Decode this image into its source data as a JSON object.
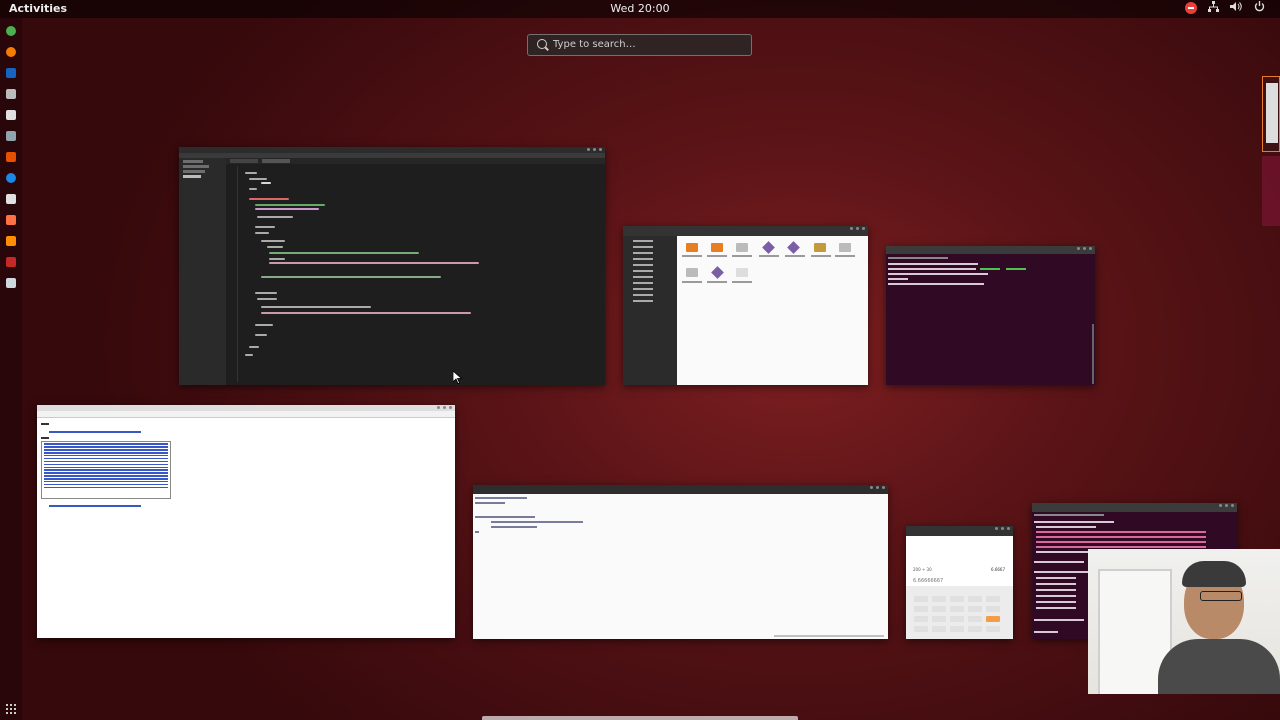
{
  "topbar": {
    "activities_label": "Activities",
    "clock": "Wed 20:00",
    "tray_icons": [
      "notification-blocked-icon",
      "network-icon",
      "volume-icon",
      "power-icon"
    ]
  },
  "search": {
    "placeholder": "Type to search…"
  },
  "dock": {
    "items": [
      "chrome-icon",
      "firefox-icon",
      "terminal-icon",
      "files-icon",
      "text-editor-icon",
      "sublime-icon",
      "settings-icon",
      "help-icon",
      "software-icon",
      "ubuntu-software-icon",
      "calculator-icon",
      "sublime-text-icon",
      "mysql-workbench-icon",
      "app-icon"
    ],
    "show_apps_icon": "show-applications-icon"
  },
  "windows": [
    {
      "id": "sublime",
      "app": "Sublime Text"
    },
    {
      "id": "files",
      "app": "Files"
    },
    {
      "id": "terminal-1",
      "app": "Terminal"
    },
    {
      "id": "browser",
      "app": "Web Browser"
    },
    {
      "id": "editor",
      "app": "SQL Editor"
    },
    {
      "id": "calculator",
      "app": "Calculator"
    },
    {
      "id": "terminal-2",
      "app": "Terminal"
    }
  ],
  "calculator": {
    "expression": "200 ÷ 30",
    "result_top": "6.6667",
    "result": "6.66666667"
  },
  "colors": {
    "accent": "#e77d2b",
    "terminal_bg": "#300a24",
    "notification_red": "#e9413a",
    "terminal_green": "#4ec24e"
  }
}
